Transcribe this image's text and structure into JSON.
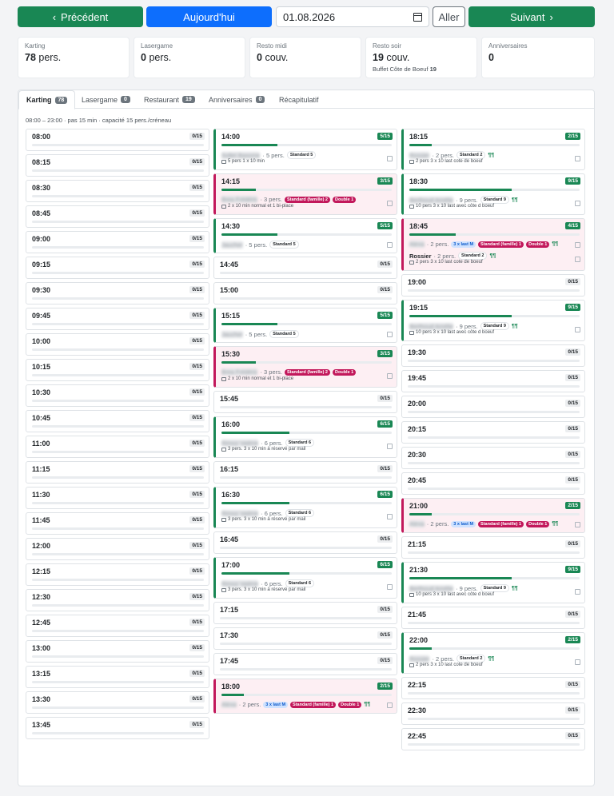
{
  "nav": {
    "prev_label": "Précédent",
    "prev_icon": "chevron-left-icon",
    "today_label": "Aujourd'hui",
    "date_value": "01.08.2026",
    "go_label": "Aller",
    "next_label": "Suivant",
    "next_icon": "chevron-right-icon"
  },
  "stats": [
    {
      "label": "Karting",
      "value": "78",
      "unit": "pers.",
      "sub": ""
    },
    {
      "label": "Lasergame",
      "value": "0",
      "unit": "pers.",
      "sub": ""
    },
    {
      "label": "Resto midi",
      "value": "0",
      "unit": "couv.",
      "sub": ""
    },
    {
      "label": "Resto soir",
      "value": "19",
      "unit": "couv.",
      "sub": "Buffet Côte de Boeuf",
      "sub_value": "19"
    },
    {
      "label": "Anniversaires",
      "value": "0",
      "unit": "",
      "sub": ""
    }
  ],
  "tabs": [
    {
      "label": "Karting",
      "badge": "78",
      "active": true
    },
    {
      "label": "Lasergame",
      "badge": "0"
    },
    {
      "label": "Restaurant",
      "badge": "19"
    },
    {
      "label": "Anniversaires",
      "badge": "0"
    },
    {
      "label": "Récapitulatif"
    }
  ],
  "info": "08:00 – 23:00 · pas 15 min · capacité 15 pers./créneau",
  "columns": [
    [
      {
        "time": "08:00",
        "cap": "0/15"
      },
      {
        "time": "08:15",
        "cap": "0/15"
      },
      {
        "time": "08:30",
        "cap": "0/15"
      },
      {
        "time": "08:45",
        "cap": "0/15"
      },
      {
        "time": "09:00",
        "cap": "0/15"
      },
      {
        "time": "09:15",
        "cap": "0/15"
      },
      {
        "time": "09:30",
        "cap": "0/15"
      },
      {
        "time": "09:45",
        "cap": "0/15"
      },
      {
        "time": "10:00",
        "cap": "0/15"
      },
      {
        "time": "10:15",
        "cap": "0/15"
      },
      {
        "time": "10:30",
        "cap": "0/15"
      },
      {
        "time": "10:45",
        "cap": "0/15"
      },
      {
        "time": "11:00",
        "cap": "0/15"
      },
      {
        "time": "11:15",
        "cap": "0/15"
      },
      {
        "time": "11:30",
        "cap": "0/15"
      },
      {
        "time": "11:45",
        "cap": "0/15"
      },
      {
        "time": "12:00",
        "cap": "0/15"
      },
      {
        "time": "12:15",
        "cap": "0/15"
      },
      {
        "time": "12:30",
        "cap": "0/15"
      },
      {
        "time": "12:45",
        "cap": "0/15"
      },
      {
        "time": "13:00",
        "cap": "0/15"
      },
      {
        "time": "13:15",
        "cap": "0/15"
      },
      {
        "time": "13:30",
        "cap": "0/15"
      },
      {
        "time": "13:45",
        "cap": "0/15"
      }
    ],
    [
      {
        "time": "14:00",
        "cap": "5/15",
        "fill": 0.33,
        "style": "green",
        "bookings": [
          {
            "name": "Sollet Baxome",
            "pers": "5 pers.",
            "tags": [
              {
                "t": "Standard 5",
                "k": "std"
              }
            ],
            "note": "5 pers 1 x 10 min"
          }
        ]
      },
      {
        "time": "14:15",
        "cap": "3/15",
        "fill": 0.2,
        "style": "pink",
        "bookings": [
          {
            "name": "Brea Frédéric",
            "pers": "3 pers.",
            "tags": [
              {
                "t": "Standard (famille) 2",
                "k": "fam"
              },
              {
                "t": "Double 1",
                "k": "fam"
              }
            ],
            "note": "2 x 10 min normal et 1 bi-place"
          }
        ]
      },
      {
        "time": "14:30",
        "cap": "5/15",
        "fill": 0.33,
        "style": "green",
        "bookings": [
          {
            "name": "Jaucher",
            "pers": "5 pers.",
            "tags": [
              {
                "t": "Standard 5",
                "k": "std"
              }
            ]
          }
        ]
      },
      {
        "time": "14:45",
        "cap": "0/15"
      },
      {
        "time": "15:00",
        "cap": "0/15"
      },
      {
        "time": "15:15",
        "cap": "5/15",
        "fill": 0.33,
        "style": "green",
        "bookings": [
          {
            "name": "Jaucher",
            "pers": "5 pers.",
            "tags": [
              {
                "t": "Standard 5",
                "k": "std"
              }
            ]
          }
        ]
      },
      {
        "time": "15:30",
        "cap": "3/15",
        "fill": 0.2,
        "style": "pink",
        "bookings": [
          {
            "name": "Brea Frédéric",
            "pers": "3 pers.",
            "tags": [
              {
                "t": "Standard (famille) 2",
                "k": "fam"
              },
              {
                "t": "Double 1",
                "k": "fam"
              }
            ],
            "note": "2 x 10 min normal et 1 bi-place"
          }
        ]
      },
      {
        "time": "15:45",
        "cap": "0/15"
      },
      {
        "time": "16:00",
        "cap": "6/15",
        "fill": 0.4,
        "style": "green",
        "bookings": [
          {
            "name": "Rimoz Valérie",
            "pers": "6 pers.",
            "tags": [
              {
                "t": "Standard 6",
                "k": "std"
              }
            ],
            "note": "3 pers. 3 x 10 min à réservé par mail"
          }
        ]
      },
      {
        "time": "16:15",
        "cap": "0/15"
      },
      {
        "time": "16:30",
        "cap": "6/15",
        "fill": 0.4,
        "style": "green",
        "bookings": [
          {
            "name": "Rimoz Valérie",
            "pers": "6 pers.",
            "tags": [
              {
                "t": "Standard 6",
                "k": "std"
              }
            ],
            "note": "3 pers. 3 x 10 min à réservé par mail"
          }
        ]
      },
      {
        "time": "16:45",
        "cap": "0/15"
      },
      {
        "time": "17:00",
        "cap": "6/15",
        "fill": 0.4,
        "style": "green",
        "bookings": [
          {
            "name": "Rimoz Valérie",
            "pers": "6 pers.",
            "tags": [
              {
                "t": "Standard 6",
                "k": "std"
              }
            ],
            "note": "3 pers. 3 x 10 min à réservé par mail"
          }
        ]
      },
      {
        "time": "17:15",
        "cap": "0/15"
      },
      {
        "time": "17:30",
        "cap": "0/15"
      },
      {
        "time": "17:45",
        "cap": "0/15"
      },
      {
        "time": "18:00",
        "cap": "2/15",
        "fill": 0.13,
        "style": "pink",
        "bookings": [
          {
            "name": "Alexa",
            "pers": "2 pers.",
            "tags": [
              {
                "t": "3 x last M",
                "k": "last"
              },
              {
                "t": "Standard (famille) 1",
                "k": "fam"
              },
              {
                "t": "Double 1",
                "k": "fam"
              }
            ],
            "fork": true
          }
        ]
      }
    ],
    [
      {
        "time": "18:15",
        "cap": "2/15",
        "fill": 0.13,
        "style": "green",
        "bookings": [
          {
            "name": "Rossier",
            "pers": "2 pers.",
            "tags": [
              {
                "t": "Standard 2",
                "k": "std"
              }
            ],
            "fork": true,
            "note": "2 pers 3 x 10 last cote de boeuf"
          }
        ]
      },
      {
        "time": "18:30",
        "cap": "9/15",
        "fill": 0.6,
        "style": "green",
        "bookings": [
          {
            "name": "Berthoud Amélie",
            "pers": "9 pers.",
            "tags": [
              {
                "t": "Standard 9",
                "k": "std"
              }
            ],
            "fork": true,
            "note": "10 pers 3 x 10 last avec côte d boeuf"
          }
        ]
      },
      {
        "time": "18:45",
        "cap": "4/15",
        "fill": 0.27,
        "style": "pink",
        "bookings": [
          {
            "name": "Alexa",
            "pers": "2 pers.",
            "tags": [
              {
                "t": "3 x last M",
                "k": "last"
              },
              {
                "t": "Standard (famille) 1",
                "k": "fam"
              },
              {
                "t": "Double 1",
                "k": "fam"
              }
            ],
            "fork": true
          },
          {
            "name": "Rossier",
            "clear": true,
            "pers": "2 pers.",
            "tags": [
              {
                "t": "Standard 2",
                "k": "std"
              }
            ],
            "fork": true,
            "note": "2 pers 3 x 10 last cote de boeuf"
          }
        ]
      },
      {
        "time": "19:00",
        "cap": "0/15"
      },
      {
        "time": "19:15",
        "cap": "9/15",
        "fill": 0.6,
        "style": "green",
        "bookings": [
          {
            "name": "Berthoud Amélie",
            "pers": "9 pers.",
            "tags": [
              {
                "t": "Standard 9",
                "k": "std"
              }
            ],
            "fork": true,
            "note": "10 pers 3 x 10 last avec côte d boeuf"
          }
        ]
      },
      {
        "time": "19:30",
        "cap": "0/15"
      },
      {
        "time": "19:45",
        "cap": "0/15"
      },
      {
        "time": "20:00",
        "cap": "0/15"
      },
      {
        "time": "20:15",
        "cap": "0/15"
      },
      {
        "time": "20:30",
        "cap": "0/15"
      },
      {
        "time": "20:45",
        "cap": "0/15"
      },
      {
        "time": "21:00",
        "cap": "2/15",
        "fill": 0.13,
        "style": "pink",
        "bookings": [
          {
            "name": "Alexa",
            "pers": "2 pers.",
            "tags": [
              {
                "t": "3 x last M",
                "k": "last"
              },
              {
                "t": "Standard (famille) 1",
                "k": "fam"
              },
              {
                "t": "Double 1",
                "k": "fam"
              }
            ],
            "fork": true
          }
        ]
      },
      {
        "time": "21:15",
        "cap": "0/15"
      },
      {
        "time": "21:30",
        "cap": "9/15",
        "fill": 0.6,
        "style": "green",
        "bookings": [
          {
            "name": "Berthoud Amélie",
            "pers": "9 pers.",
            "tags": [
              {
                "t": "Standard 9",
                "k": "std"
              }
            ],
            "fork": true,
            "note": "10 pers 3 x 10 last avec côte d boeuf"
          }
        ]
      },
      {
        "time": "21:45",
        "cap": "0/15"
      },
      {
        "time": "22:00",
        "cap": "2/15",
        "fill": 0.13,
        "style": "green",
        "bookings": [
          {
            "name": "Rossier",
            "pers": "2 pers.",
            "tags": [
              {
                "t": "Standard 2",
                "k": "std"
              }
            ],
            "fork": true,
            "note": "2 pers 3 x 10 last cote de boeuf"
          }
        ]
      },
      {
        "time": "22:15",
        "cap": "0/15"
      },
      {
        "time": "22:30",
        "cap": "0/15"
      },
      {
        "time": "22:45",
        "cap": "0/15"
      }
    ]
  ],
  "colors": {
    "green": "#198754",
    "blue": "#0d6efd",
    "pink": "#c2185b"
  }
}
